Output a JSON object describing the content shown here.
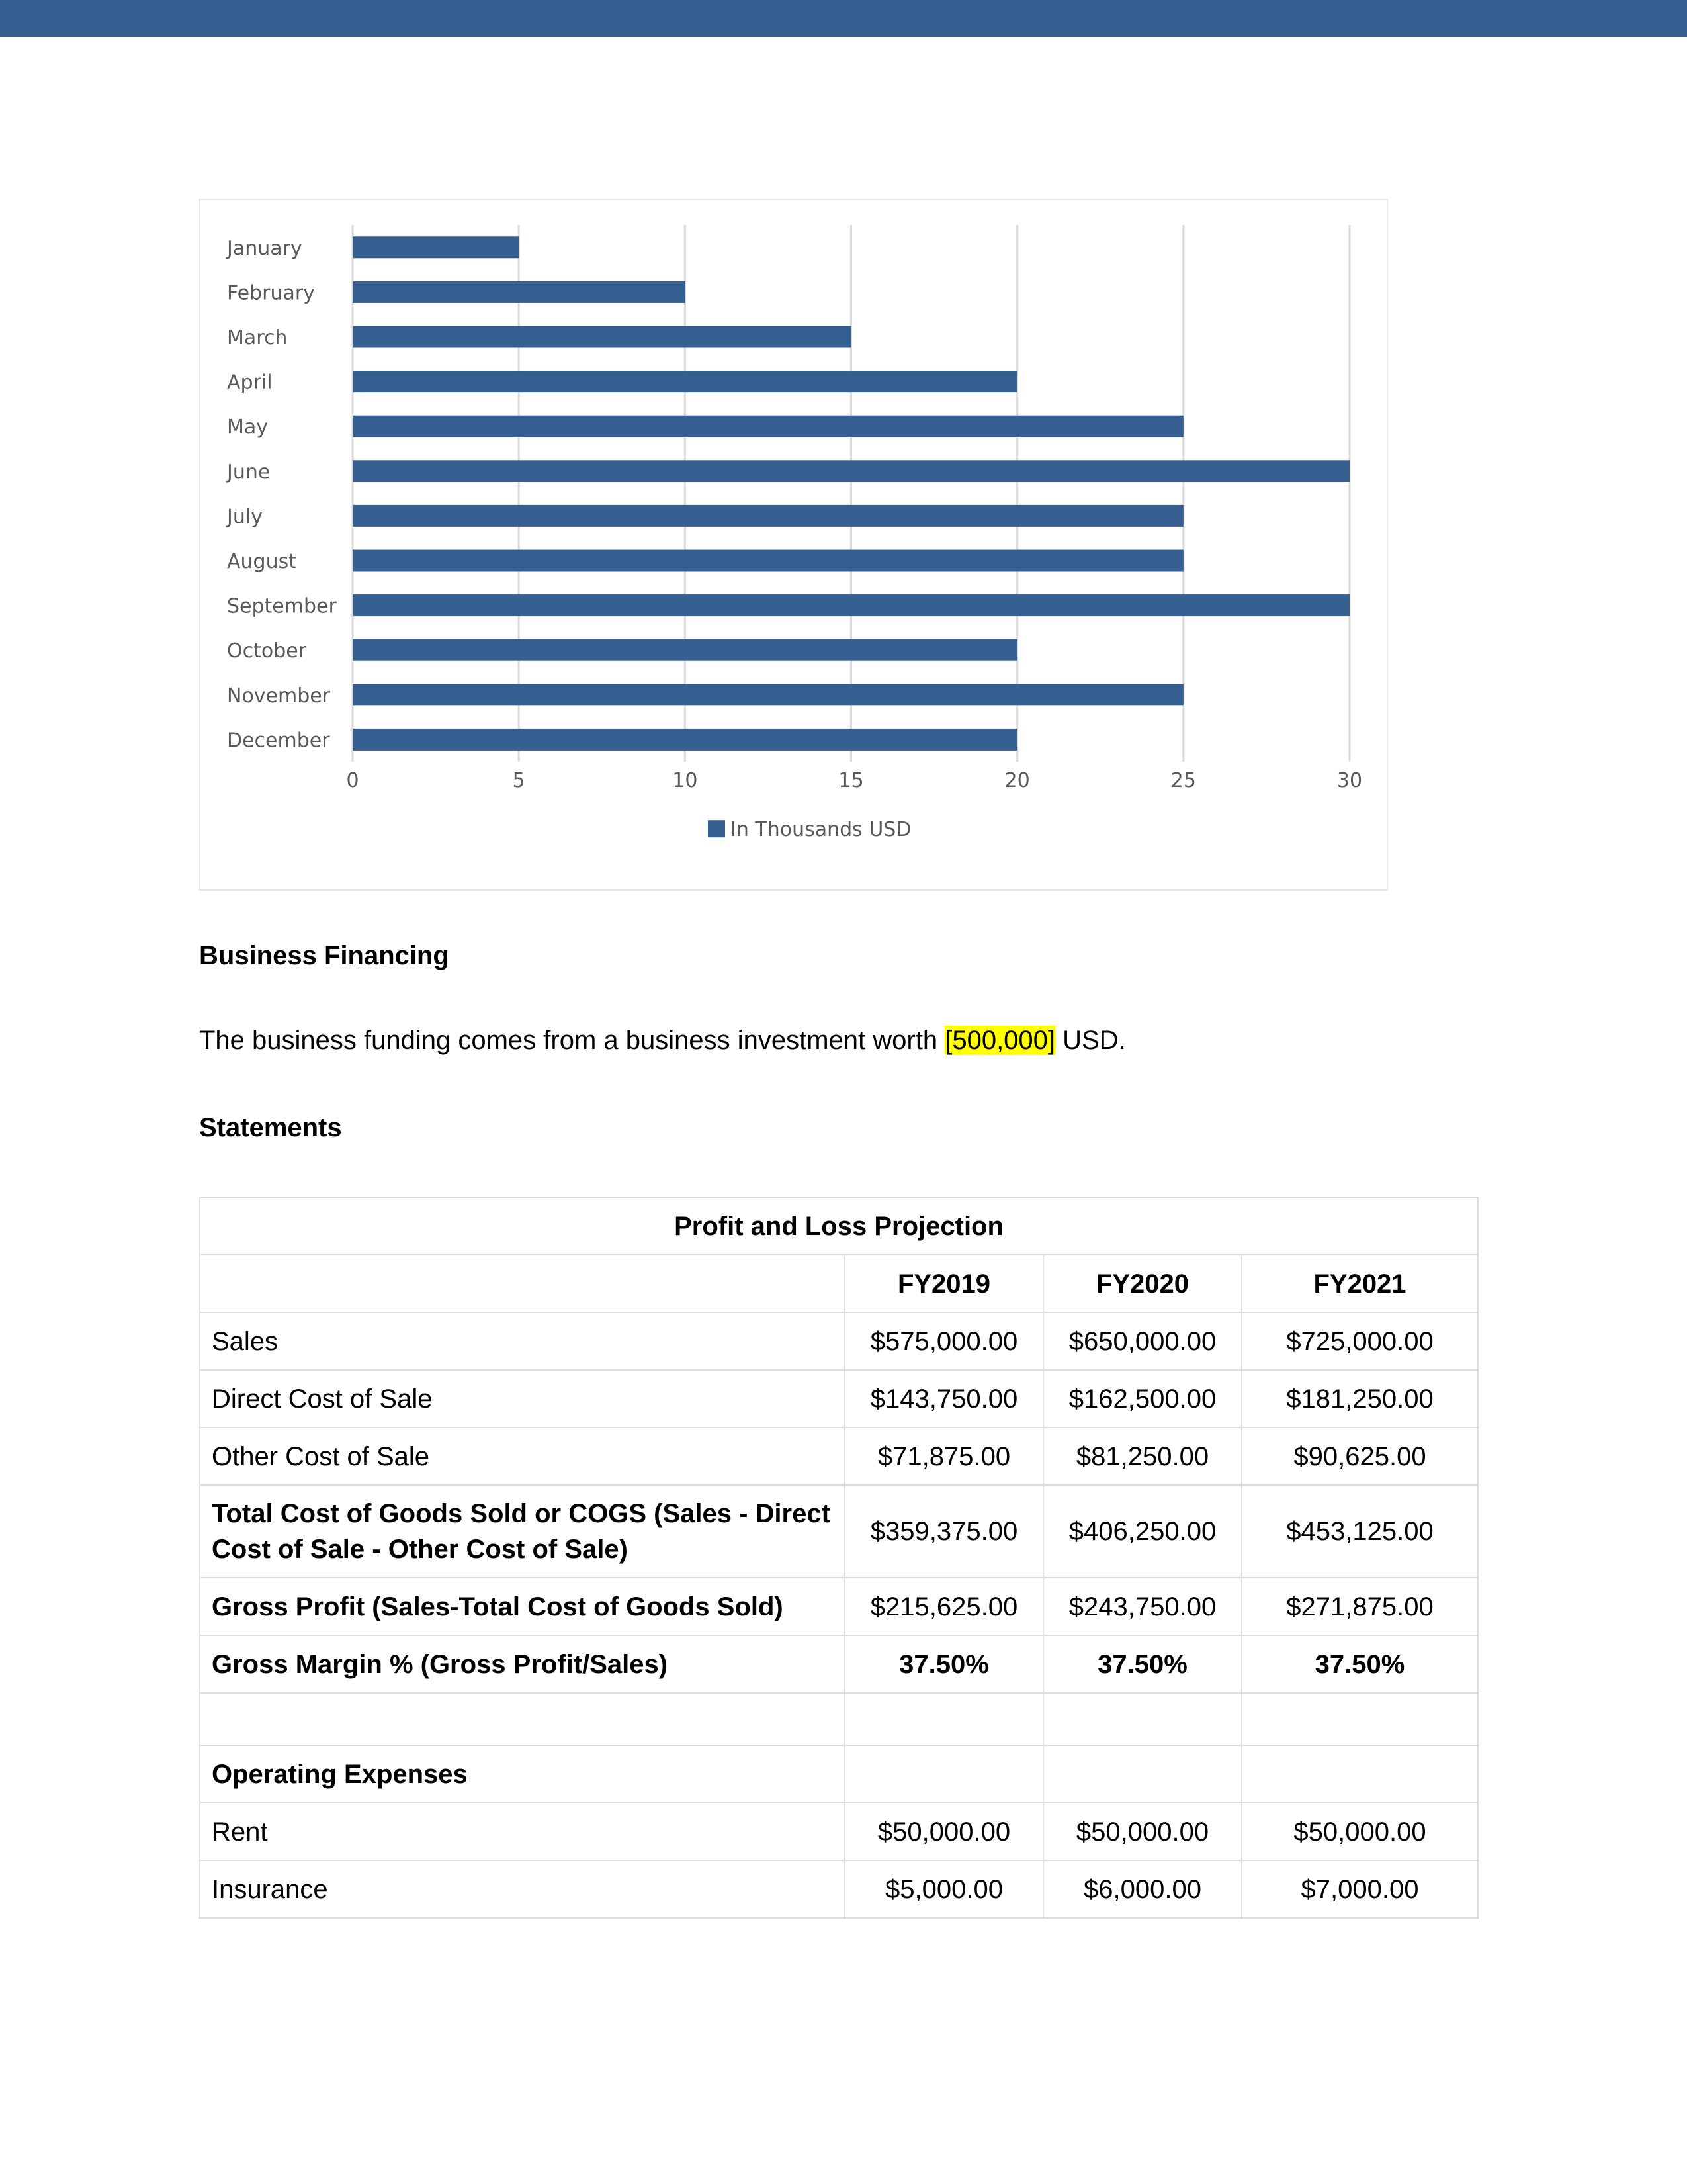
{
  "chart_data": {
    "type": "bar",
    "orientation": "horizontal",
    "categories": [
      "January",
      "February",
      "March",
      "April",
      "May",
      "June",
      "July",
      "August",
      "September",
      "October",
      "November",
      "December"
    ],
    "series": [
      {
        "name": "In Thousands USD",
        "values": [
          5,
          10,
          15,
          20,
          25,
          30,
          25,
          25,
          30,
          20,
          25,
          20
        ]
      }
    ],
    "xlim": [
      0,
      30
    ],
    "xticks": [
      0,
      5,
      10,
      15,
      20,
      25,
      30
    ],
    "grid": true,
    "legend": "bottom",
    "bar_color": "#365F91",
    "grid_color": "#d9d9d9"
  },
  "colors": {
    "top_band": "#365F91",
    "highlight": "#ffff00"
  },
  "financing": {
    "heading": "Business Financing",
    "text_before": "The business funding comes from a business investment worth ",
    "highlight": "[500,000]",
    "text_after": " USD."
  },
  "statements": {
    "heading": "Statements"
  },
  "pl_table": {
    "title": "Profit and Loss Projection",
    "headers": [
      "FY2019",
      "FY2020",
      "FY2021"
    ],
    "rows": [
      {
        "label": "Sales",
        "values": [
          "$575,000.00",
          "$650,000.00",
          "$725,000.00"
        ]
      },
      {
        "label": "Direct Cost of Sale",
        "values": [
          "$143,750.00",
          "$162,500.00",
          "$181,250.00"
        ]
      },
      {
        "label": "Other Cost of Sale",
        "values": [
          "$71,875.00",
          "$81,250.00",
          "$90,625.00"
        ]
      },
      {
        "label": "Total Cost of Goods Sold or COGS (Sales - Direct Cost of Sale - Other Cost of Sale)",
        "values": [
          "$359,375.00",
          "$406,250.00",
          "$453,125.00"
        ]
      },
      {
        "label": "Gross Profit (Sales-Total Cost of Goods Sold)",
        "values": [
          "$215,625.00",
          "$243,750.00",
          "$271,875.00"
        ]
      },
      {
        "label": "Gross Margin % (Gross Profit/Sales)",
        "values": [
          "37.50%",
          "37.50%",
          "37.50%"
        ]
      },
      {
        "label": "",
        "values": [
          "",
          "",
          ""
        ]
      },
      {
        "label": "Operating Expenses",
        "values": [
          "",
          "",
          ""
        ]
      },
      {
        "label": "Rent",
        "values": [
          "$50,000.00",
          "$50,000.00",
          "$50,000.00"
        ]
      },
      {
        "label": "Insurance",
        "values": [
          "$5,000.00",
          "$6,000.00",
          "$7,000.00"
        ]
      }
    ]
  }
}
